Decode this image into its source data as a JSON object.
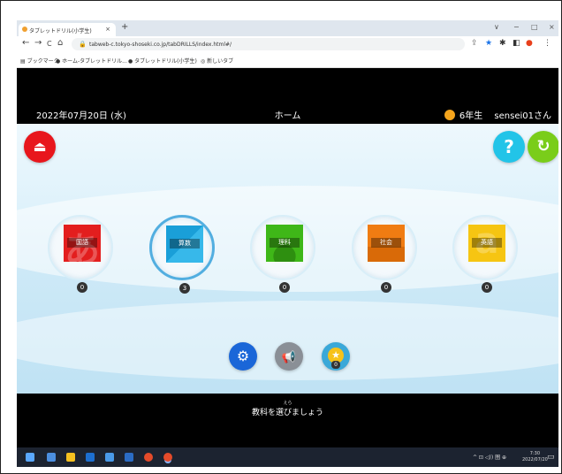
{
  "browser": {
    "tab_title": "タブレットドリル(小学生)",
    "tab_close": "×",
    "new_tab": "+",
    "window_controls": [
      "∨",
      "−",
      "□",
      "×"
    ],
    "nav": {
      "back": "←",
      "forward": "→",
      "reload": "C",
      "home": "⌂"
    },
    "url": "tabweb-c.tokyo-shoseki.co.jp/tabDRILLS/index.html#/",
    "bookmarks": [
      "ブックマーク",
      "ホーム-タブレットドリル...",
      "タブレットドリル(小学生)",
      "新しいタブ"
    ]
  },
  "header": {
    "date": "2022年07月20日 (水)",
    "title": "ホーム",
    "grade": "6年生",
    "user": "sensei01さん"
  },
  "top_buttons": {
    "logout": "⏏",
    "help": "?",
    "refresh": "↻"
  },
  "subjects": [
    {
      "label": "国語",
      "glyph": "あ",
      "count": "0",
      "color": "#e31e1e"
    },
    {
      "label": "算数",
      "glyph": "",
      "count": "3",
      "color": "#1a9fd8"
    },
    {
      "label": "理科",
      "glyph": "",
      "count": "0",
      "color": "#3fb718"
    },
    {
      "label": "社会",
      "glyph": "",
      "count": "0",
      "color": "#f07c12"
    },
    {
      "label": "英語",
      "glyph": "a",
      "count": "0",
      "color": "#f6c512"
    }
  ],
  "bottom_buttons": {
    "settings": "⚙",
    "announce": "📢",
    "badge_star": "★",
    "badge_count": "0"
  },
  "message": {
    "ruby": "えら",
    "text": "教科を選びましょう"
  },
  "taskbar": {
    "tray": "^ ⊡ ◁)) 圏 ⊕",
    "time": "7:30",
    "date": "2022/07/20",
    "notif": "▭"
  }
}
